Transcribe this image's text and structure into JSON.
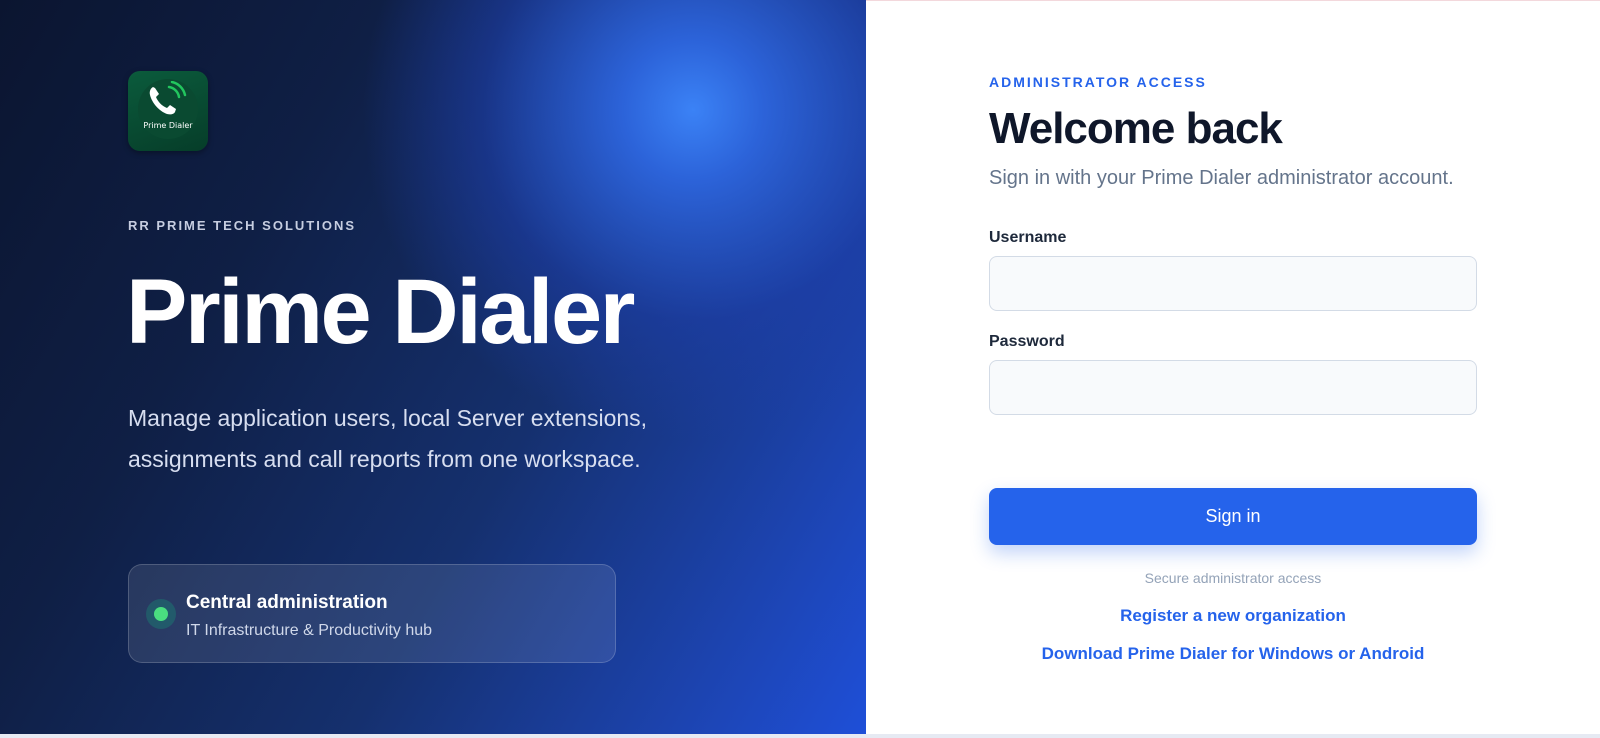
{
  "hero": {
    "logo_text": "Prime Dialer",
    "kicker": "RR PRIME TECH SOLUTIONS",
    "title": "Prime Dialer",
    "description": "Manage application users, local Server extensions, assignments and call reports from one workspace.",
    "feature": {
      "title": "Central administration",
      "subtitle": "IT Infrastructure & Productivity hub"
    }
  },
  "login": {
    "eyebrow": "ADMINISTRATOR ACCESS",
    "title": "Welcome back",
    "subtitle": "Sign in with your Prime Dialer administrator account.",
    "username_label": "Username",
    "username_value": "",
    "password_label": "Password",
    "password_value": "",
    "signin_label": "Sign in",
    "secure_note": "Secure administrator access",
    "register_link": "Register a new organization",
    "download_link": "Download Prime Dialer for Windows or Android"
  },
  "colors": {
    "accent": "#2563eb",
    "status_dot": "#4ade80",
    "hero_dark": "#0b1530",
    "hero_blue": "#1e4fd8"
  }
}
